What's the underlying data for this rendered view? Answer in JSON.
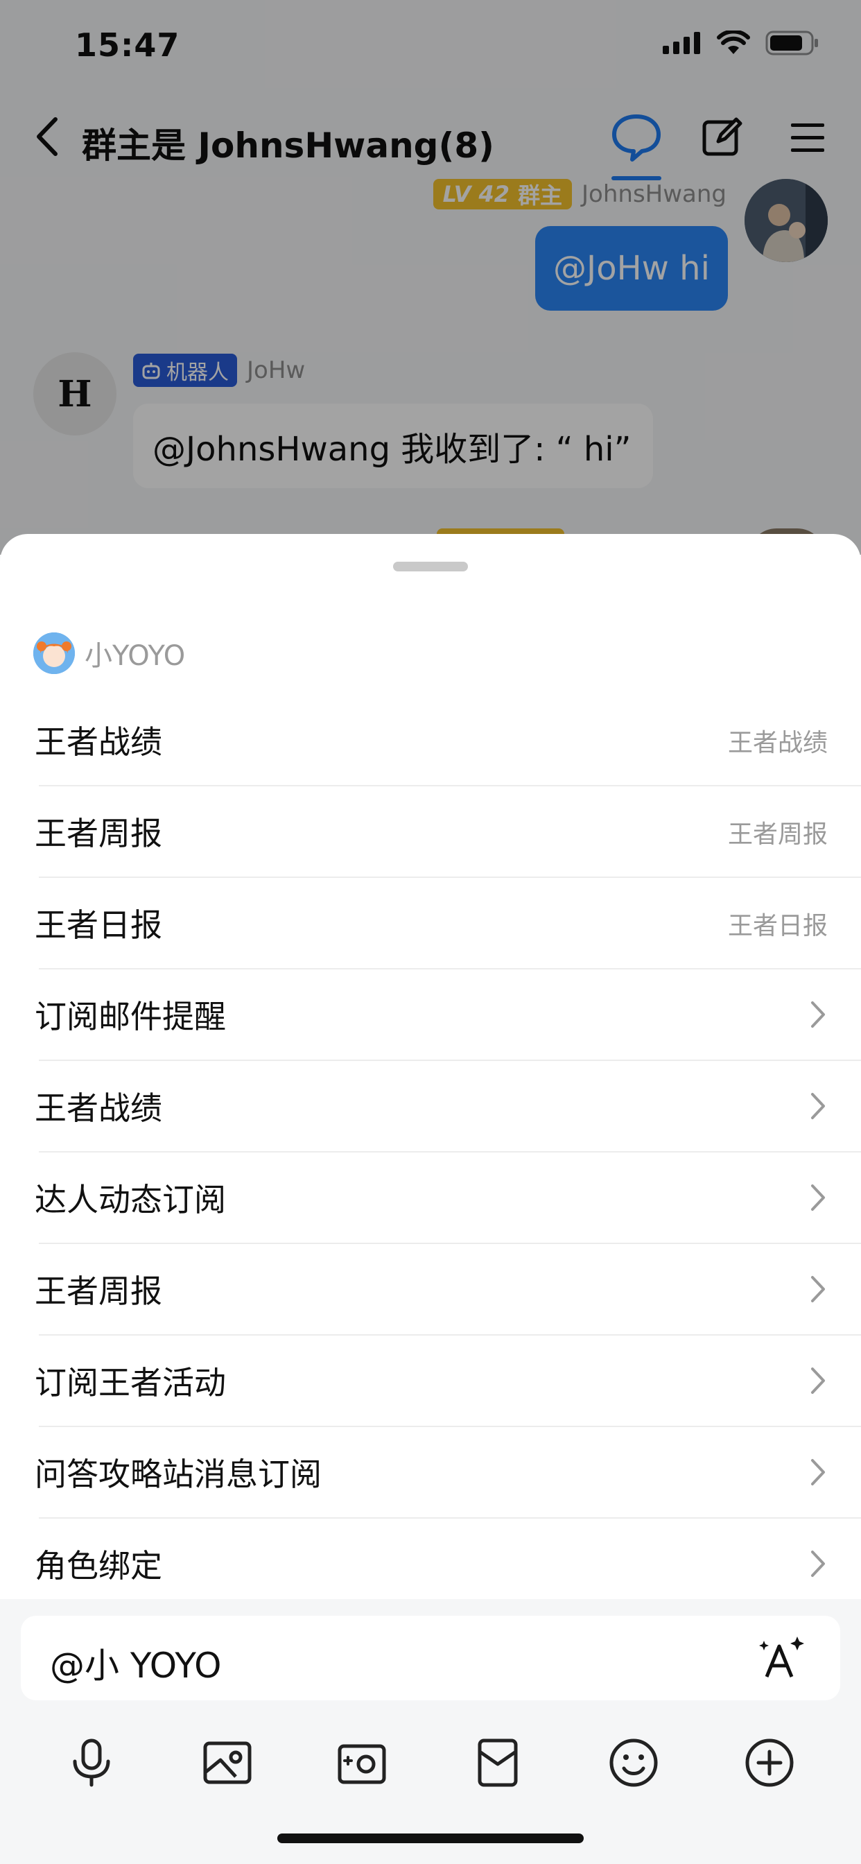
{
  "status_bar": {
    "time": "15:47"
  },
  "nav": {
    "title": "群主是 JohnsHwang(8)"
  },
  "chat": {
    "my_message": {
      "level_badge": "LV 42",
      "role": "群主",
      "sender": "JohnsHwang",
      "text": "@JoHw hi"
    },
    "bot_message": {
      "avatar_letter": "H",
      "badge": "机器人",
      "sender": "JoHw",
      "text": "@JohnsHwang 我收到了: “ hi”"
    }
  },
  "sheet": {
    "bot_name": "小YOYO",
    "commands": [
      {
        "label": "王者战绩",
        "hint": "王者战绩",
        "kind": "hint"
      },
      {
        "label": "王者周报",
        "hint": "王者周报",
        "kind": "hint"
      },
      {
        "label": "王者日报",
        "hint": "王者日报",
        "kind": "hint"
      },
      {
        "label": "订阅邮件提醒",
        "kind": "chevron"
      },
      {
        "label": "王者战绩",
        "kind": "chevron"
      },
      {
        "label": "达人动态订阅",
        "kind": "chevron"
      },
      {
        "label": "王者周报",
        "kind": "chevron"
      },
      {
        "label": "订阅王者活动",
        "kind": "chevron"
      },
      {
        "label": "问答攻略站消息订阅",
        "kind": "chevron"
      },
      {
        "label": "角色绑定",
        "kind": "chevron"
      }
    ]
  },
  "input": {
    "value": "@小 YOYO"
  },
  "toolbar": {
    "tools": [
      "microphone-icon",
      "image-icon",
      "camera-icon",
      "red-packet-icon",
      "emoji-icon",
      "plus-icon"
    ]
  },
  "colors": {
    "accent": "#1f7aef",
    "bubble": "#2b86f5",
    "level_badge": "#f3c12c",
    "bot_badge": "#2a5bd7"
  }
}
